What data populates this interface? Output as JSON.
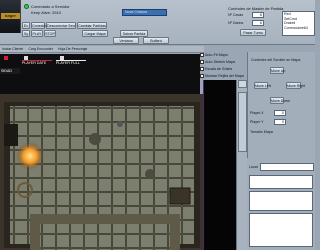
{
  "header": {
    "logo_text": "bager",
    "status_line1": "Conectado a Servidor",
    "status_line2": "Keep Alive: 2510",
    "dropdown_value": "Nova Criatura",
    "buttons_row1": [
      "Ev",
      "Conexión",
      "Desconectar Serv",
      "Cambiar Partidas"
    ],
    "buttons_row2": [
      "Sy",
      "PLAY",
      "STOP",
      "Cargar Mapa",
      "Salvar Partida"
    ],
    "buttons_row3": [
      "Ventana",
      "Buffard"
    ],
    "tabs": [
      "Iniciar Cliente",
      "Carg Encounter",
      "Hoja De Personaje"
    ]
  },
  "mode_panel": {
    "title": "Controles de Master de Partida",
    "rows_label": "Nº Cavas",
    "rows_value": "6",
    "cols_label": "Nº Dados",
    "cols_value": "6",
    "pass_turn_button": "Pasar Turno",
    "players": [
      "Red",
      "SetCmd",
      "Drakeil",
      "Commodore64"
    ]
  },
  "infobar": {
    "left_label": "SIDAD",
    "player_label": "PLAYER DATE",
    "player_full": "PLAYER FULL"
  },
  "map_options": {
    "auto_fit": "Auto-Fit Mapa",
    "auto_stretch": "Auto-Stretch Mapa",
    "gray_scale": "Escala de Grises",
    "show_grid": "Mostrar Rejilla del Mapa"
  },
  "map_controls": {
    "title": "Controles del Scroller en Mapa",
    "move_up": "Move Up",
    "move_left": "Move Left",
    "move_right": "Move Right",
    "move_down": "Move Down",
    "player_x_label": "Player X",
    "player_x_value": "0",
    "player_y_label": "Player Y",
    "player_y_value": "0",
    "map_size_label": "Tamaño Mapa"
  },
  "chat": {
    "label": "Local"
  },
  "colors": {
    "accent_blue": "#3a6fb0",
    "status_green": "#2bd34a"
  }
}
